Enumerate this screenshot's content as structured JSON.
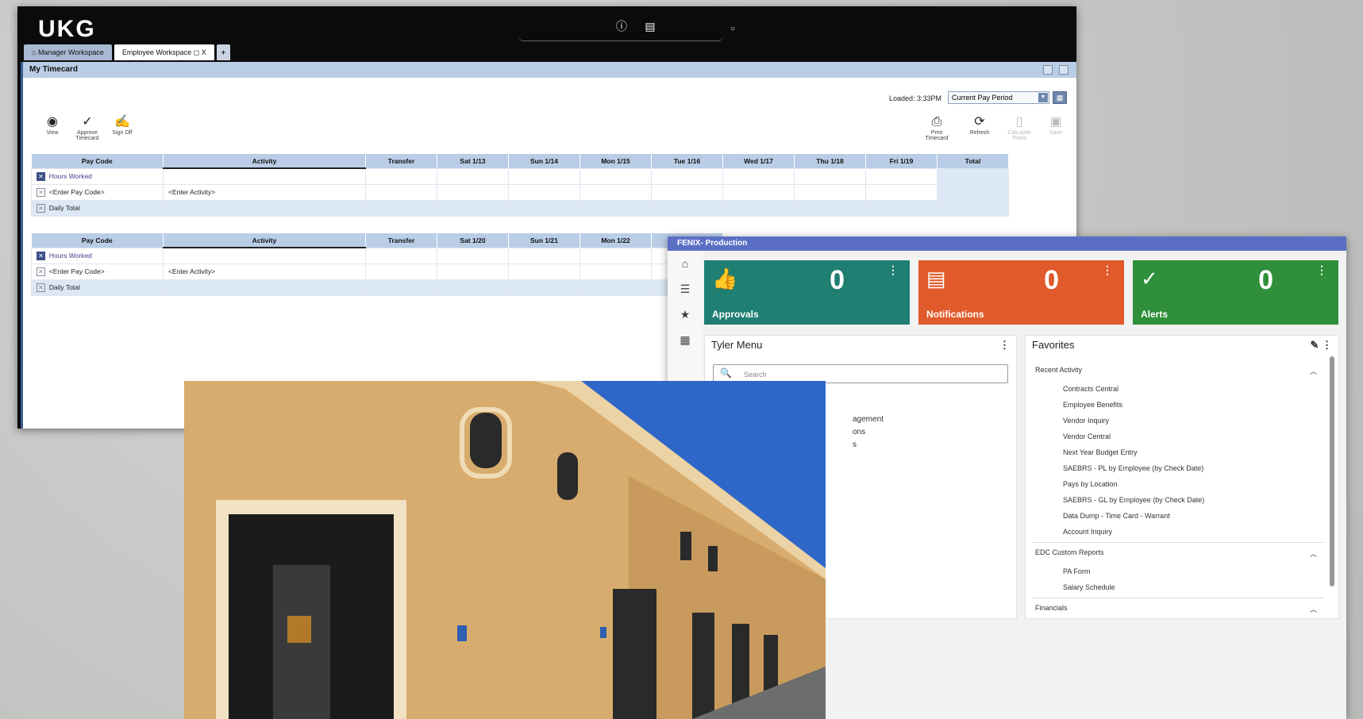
{
  "ukg": {
    "logo": "UKG",
    "tabs": [
      "Manager Workspace",
      "Employee Workspace"
    ],
    "tab_close": "X",
    "tab_add": "+",
    "panel_title": "My Timecard",
    "loaded": "Loaded: 3:33PM",
    "period": "Current Pay Period",
    "toolbar": {
      "view": "View",
      "approve": "Approve Timecard",
      "signoff": "Sign Off",
      "print": "Print Timecard",
      "refresh": "Refresh",
      "calculate": "Calculate Totals",
      "save": "Save"
    },
    "table1": {
      "headers": [
        "Pay Code",
        "Activity",
        "Transfer",
        "Sat 1/13",
        "Sun 1/14",
        "Mon 1/15",
        "Tue 1/16",
        "Wed 1/17",
        "Thu 1/18",
        "Fri 1/19",
        "Total"
      ],
      "rows": [
        "Hours Worked",
        "<Enter Pay Code>",
        "Daily Total"
      ],
      "activity_placeholder": "<Enter Activity>"
    },
    "table2": {
      "headers": [
        "Pay Code",
        "Activity",
        "Transfer",
        "Sat 1/20",
        "Sun 1/21",
        "Mon 1/22"
      ],
      "rows": [
        "Hours Worked",
        "<Enter Pay Code>",
        "Daily Total"
      ],
      "activity_placeholder": "<Enter Activity>"
    }
  },
  "fenix": {
    "title": "FENIX- Production",
    "cards": [
      {
        "label": "Approvals",
        "count": "0",
        "color": "#1f7f72"
      },
      {
        "label": "Notifications",
        "count": "0",
        "color": "#e05a2b"
      },
      {
        "label": "Alerts",
        "count": "0",
        "color": "#2f8f3a"
      }
    ],
    "menu": {
      "title": "Tyler Menu",
      "search_placeholder": "Search",
      "partial_items": [
        "agement",
        "ons",
        "s"
      ]
    },
    "favorites": {
      "title": "Favorites",
      "sections": [
        {
          "name": "Recent Activity",
          "items": [
            "Contracts Central",
            "Employee Benefits",
            "Vendor Inquiry",
            "Vendor Central",
            "Next Year Budget Entry",
            "SAEBRS - PL by Employee (by Check Date)",
            "Pays by Location",
            "SAEBRS - GL by Employee (by Check Date)",
            "Data Dump - Time Card - Warrant",
            "Account Inquiry"
          ]
        },
        {
          "name": "EDC Custom Reports",
          "items": [
            "PA Form",
            "Salary Schedule"
          ]
        },
        {
          "name": "Financials",
          "items": []
        }
      ]
    }
  }
}
